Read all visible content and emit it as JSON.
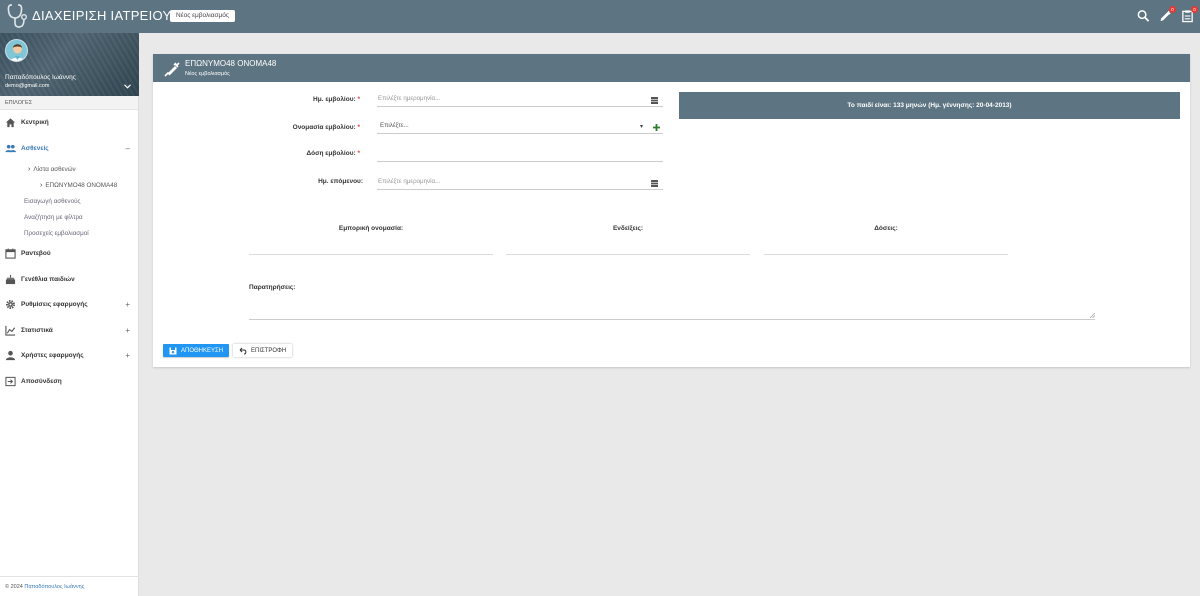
{
  "header": {
    "app_title": "ΔΙΑΧΕΙΡΙΣΗ ΙΑΤΡΕΙΟΥ",
    "breadcrumb_button": "Νέος εμβολιασμός",
    "notifications_count": "0",
    "inbox_count": "0"
  },
  "profile": {
    "name": "Παπαδόπουλος Ιωάννης",
    "email": "demo@gmail.com"
  },
  "sidebar": {
    "section_label": "ΕΠΙΛΟΓΕΣ",
    "items": [
      {
        "label": "Κεντρική",
        "icon": "home-icon"
      },
      {
        "label": "Ασθενείς",
        "icon": "people-icon",
        "toggle": "–"
      },
      {
        "label": "Ραντεβού",
        "icon": "calendar-icon"
      },
      {
        "label": "Γενέθλια παιδιών",
        "icon": "cake-icon"
      },
      {
        "label": "Ρυθμίσεις εφαρμογής",
        "icon": "gear-icon",
        "toggle": "+"
      },
      {
        "label": "Στατιστικά",
        "icon": "chart-icon",
        "toggle": "+"
      },
      {
        "label": "Χρήστες εφαρμογής",
        "icon": "user-icon",
        "toggle": "+"
      },
      {
        "label": "Αποσύνδεση",
        "icon": "logout-icon"
      }
    ],
    "patients_sub": {
      "list": "Λίστα ασθενών",
      "current_patient": "ΕΠΩΝΥΜΟ48 ΟΝΟΜΑ48",
      "add": "Εισαγωγή ασθενούς",
      "filter_search": "Αναζήτηση με φίλτρα",
      "upcoming": "Προσεχείς εμβολιασμοί"
    },
    "footer_prefix": "© 2024",
    "footer_link": "Παπαδόπουλος Ιωάννης"
  },
  "card": {
    "title": "ΕΠΩΝΥΜΟ48 ΟΝΟΜΑ48",
    "subtitle": "Νέος εμβολιασμός",
    "info": "Το παιδί είναι: 133 μηνών (Ημ. γέννησης: 20-04-2013)"
  },
  "form": {
    "date_label": "Ημ. εμβολίου:",
    "date_placeholder": "Επιλέξτε ημερομηνία...",
    "vaccine_label": "Ονομασία εμβολίου:",
    "vaccine_placeholder": "Επιλέξτε...",
    "dose_label": "Δόση εμβολίου:",
    "next_label": "Ημ. επόμενου:",
    "next_placeholder": "Επιλέξτε ημερομηνία...",
    "required_mark": "*",
    "col_trade_name": "Εμπορική ονομασία:",
    "col_indications": "Ενδείξεις:",
    "col_doses": "Δόσεις:",
    "notes_label": "Παρατηρήσεις:",
    "save_button": "ΑΠΟΘΗΚΕΥΣΗ",
    "back_button": "ΕΠΙΣΤΡΟΦΗ"
  },
  "colors": {
    "primary": "#5d7482",
    "accent_blue": "#2196f3",
    "link_blue": "#3a7ab8",
    "required_red": "#e53935",
    "add_green": "#2e7d32"
  }
}
